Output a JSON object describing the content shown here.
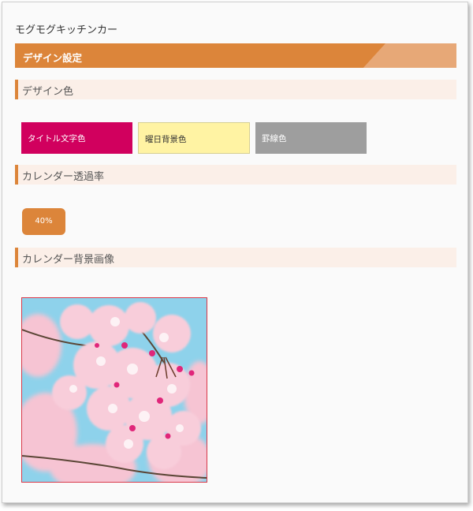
{
  "app": {
    "title": "モグモグキッチンカー"
  },
  "design_settings": {
    "title": "デザイン設定",
    "colors": {
      "heading": "デザイン色",
      "swatches": [
        {
          "label": "タイトル文字色",
          "color": "#d1005e",
          "text_color": "#ffffff"
        },
        {
          "label": "曜日背景色",
          "color": "#fff3a3",
          "text_color": "#333333"
        },
        {
          "label": "罫線色",
          "color": "#9e9e9e",
          "text_color": "#ffffff"
        }
      ]
    },
    "opacity": {
      "heading": "カレンダー透過率",
      "value": "40%"
    },
    "background_image": {
      "heading": "カレンダー背景画像"
    }
  },
  "theme": {
    "accent": "#dc853a",
    "accent_light": "#e7a877",
    "subheader_bg": "#fbefe8",
    "image_border": "#d9394a"
  }
}
